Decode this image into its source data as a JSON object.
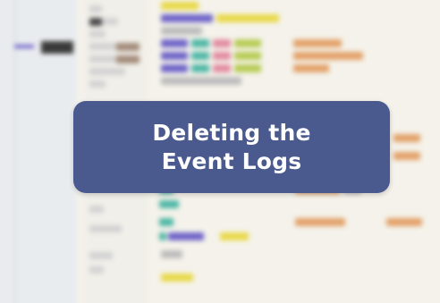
{
  "overlay": {
    "title": "Deleting the\nEvent Logs"
  },
  "background": {
    "description_free": true,
    "accent_colors": {
      "overlay_bg": "#4a5a8f",
      "highlight_yellow": "#e9d94a",
      "purple": "#6f64c8",
      "teal": "#4fb7a6"
    }
  }
}
